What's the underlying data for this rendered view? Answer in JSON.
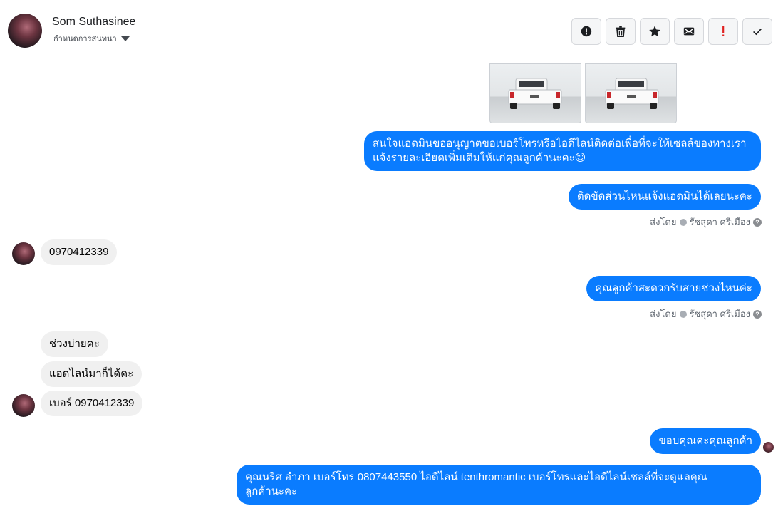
{
  "header": {
    "contact_name": "Som Suthasinee",
    "subtitle": "กำหนดการสนทนา",
    "toolbar": {
      "spam_icon": "alert-circle-icon",
      "delete_icon": "trash-icon",
      "star_icon": "star-icon",
      "mark_unread_icon": "envelope-icon",
      "important_icon": "exclamation-icon",
      "done_icon": "checkmark-icon"
    }
  },
  "messages": {
    "m1": "สนใจแอดมินขออนุญาตขอเบอร์โทรหรือไอดีไลน์ติดต่อเพื่อที่จะให้เซลล์ของทางเรา",
    "m1b": "แจ้งรายละเอียดเพิ่มเติมให้แก่คุณลูกค้านะคะ😊",
    "m2": "ติดขัดส่วนไหนแจ้งแอดมินได้เลยนะคะ",
    "sent_by_1": "ส่งโดย",
    "agent_1": "รัชสุดา ศรีเมือง",
    "m3": "0970412339",
    "m4": "คุณลูกค้าสะดวกรับสายช่วงไหนค่ะ",
    "sent_by_2": "ส่งโดย",
    "agent_2": "รัชสุดา ศรีเมือง",
    "m5": "ช่วงบ่ายคะ",
    "m6": "แอดไลน์มาก็ได้คะ",
    "m7": "เบอร์ 0970412339",
    "m8": "ขอบคุณค่ะคุณลูกค้า",
    "m9": "คุณนริศ อำภา  เบอร์โทร 0807443550  ไอดีไลน์ tenthromantic   เบอร์โทรและไอดีไลน์เซลล์ที่จะดูแลคุณ",
    "m9b": "ลูกค้านะคะ"
  },
  "colors": {
    "outgoing_bubble": "#0a7cff",
    "incoming_bubble": "#f0f0f0",
    "important_red": "#e02020"
  }
}
